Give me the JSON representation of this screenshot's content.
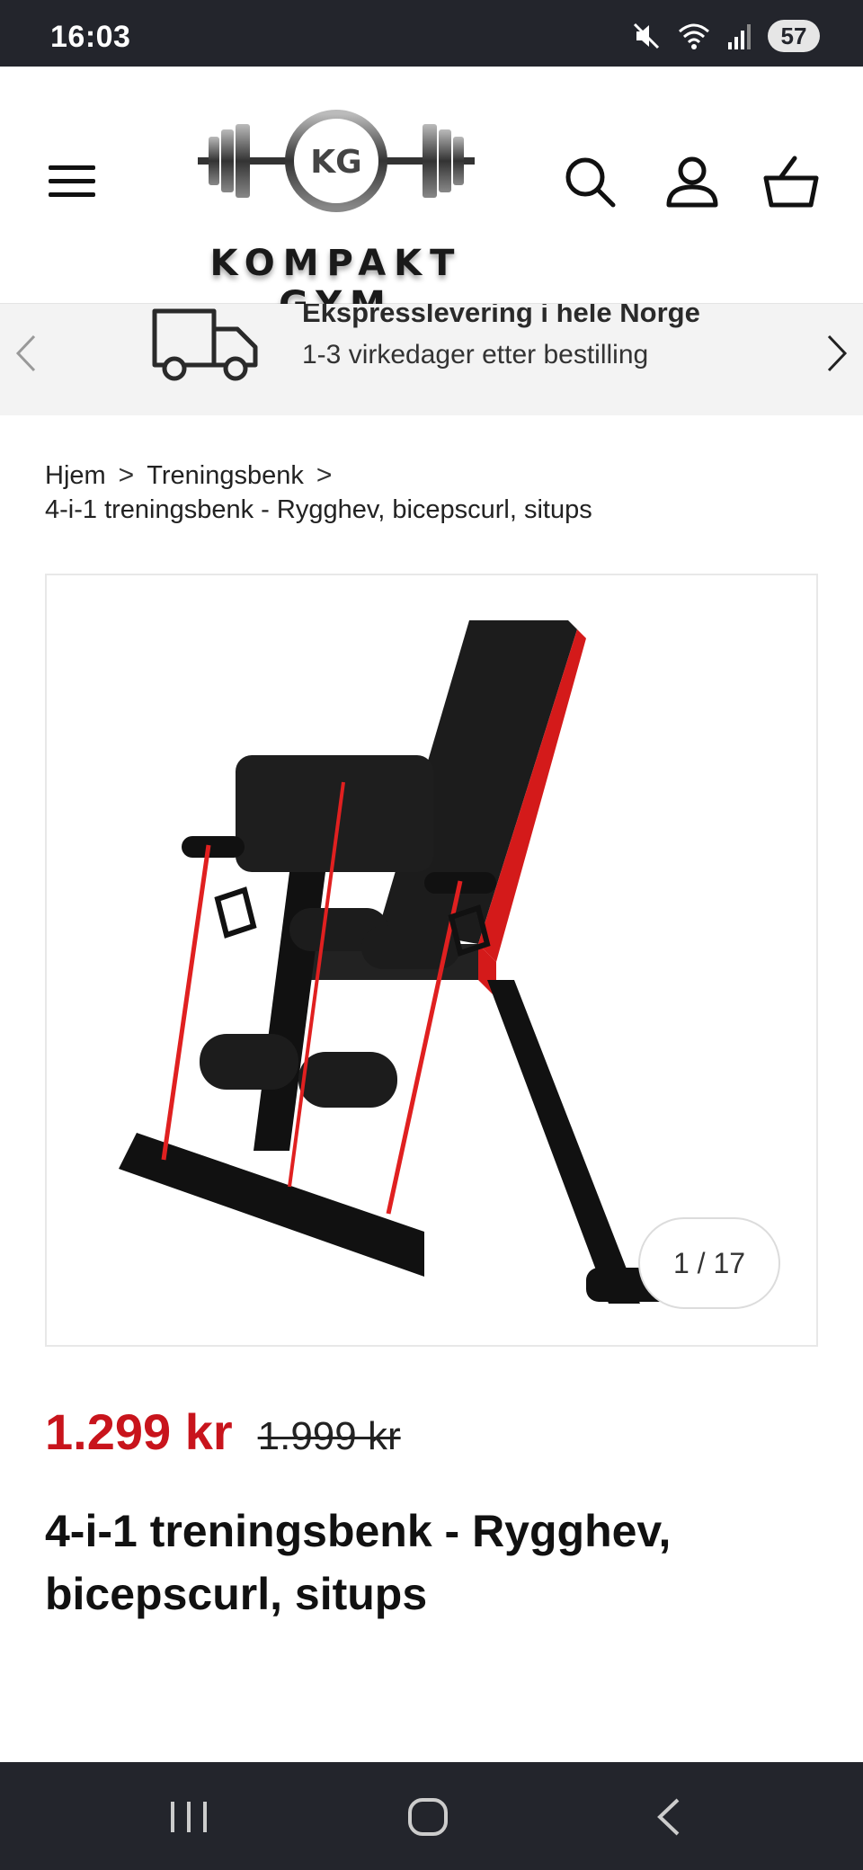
{
  "status_bar": {
    "time": "16:03",
    "battery": "57",
    "icons": [
      "mute-icon",
      "wifi-icon",
      "signal-icon",
      "battery-icon"
    ]
  },
  "header": {
    "logo_initials": "KG",
    "logo_text": "KOMPAKT GYM",
    "icons": [
      "menu-icon",
      "search-icon",
      "account-icon",
      "cart-icon"
    ]
  },
  "promo": {
    "title": "Ekspresslevering i hele Norge",
    "subtitle": "1-3 virkedager etter bestilling",
    "icons": [
      "chevron-left-icon",
      "truck-icon",
      "chevron-right-icon"
    ]
  },
  "breadcrumb": {
    "items": [
      "Hjem",
      "Treningsbenk"
    ],
    "current": "4-i-1 treningsbenk - Rygghev, bicepscurl, situps",
    "separator": ">"
  },
  "gallery": {
    "counter": "1 / 17"
  },
  "product": {
    "price": "1.299 kr",
    "compare_price": "1.999 kr",
    "title": "4-i-1 treningsbenk - Rygghev, bicepscurl, situps"
  },
  "colors": {
    "sale_price": "#c8141c",
    "status_bar": "#23252c",
    "promo_bg": "#f3f3f3"
  },
  "nav_bar": {
    "icons": [
      "recent-apps-icon",
      "home-icon",
      "back-icon"
    ]
  }
}
